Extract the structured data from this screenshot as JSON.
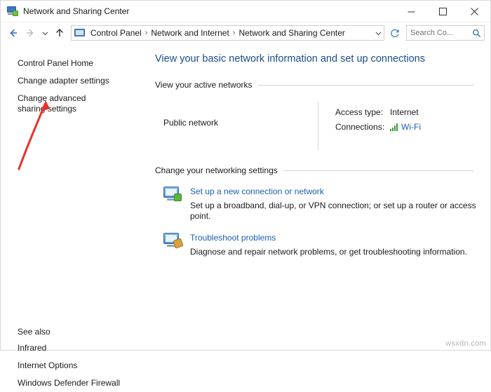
{
  "window": {
    "title": "Network and Sharing Center",
    "app_icon": "network-icon",
    "controls": {
      "minimize": "minimize-icon",
      "maximize": "maximize-icon",
      "close": "close-icon"
    }
  },
  "addressbar": {
    "back": "back-arrow-icon",
    "forward": "forward-arrow-icon",
    "recent": "chevron-down-icon",
    "up": "up-arrow-icon",
    "breadcrumb_icon": "control-panel-icon",
    "breadcrumbs": [
      "Control Panel",
      "Network and Internet",
      "Network and Sharing Center"
    ],
    "separator": "›",
    "dropdown": "chevron-down-icon",
    "refresh": "refresh-icon",
    "search": {
      "placeholder": "Search Co...",
      "icon": "search-icon",
      "value": ""
    }
  },
  "sidebar": {
    "items": [
      {
        "label": "Control Panel Home",
        "name": "sidebar-item-control-panel-home"
      },
      {
        "label": "Change adapter settings",
        "name": "sidebar-item-change-adapter-settings"
      },
      {
        "label": "Change advanced sharing settings",
        "name": "sidebar-item-change-advanced-sharing-settings"
      }
    ],
    "see_also": {
      "heading": "See also",
      "items": [
        {
          "label": "Infrared",
          "name": "sidebar-item-infrared"
        },
        {
          "label": "Internet Options",
          "name": "sidebar-item-internet-options"
        },
        {
          "label": "Windows Defender Firewall",
          "name": "sidebar-item-windows-defender-firewall"
        }
      ]
    }
  },
  "main": {
    "page_title": "View your basic network information and set up connections",
    "active_networks": {
      "heading": "View your active networks",
      "network_name": "Public network",
      "details": [
        {
          "label": "Access type:",
          "value": "Internet"
        },
        {
          "label": "Connections:",
          "value": "Wi-Fi"
        }
      ]
    },
    "settings": {
      "heading": "Change your networking settings",
      "tasks": [
        {
          "icon": "new-connection-icon",
          "link": "Set up a new connection or network",
          "desc": "Set up a broadband, dial-up, or VPN connection; or set up a router or access point."
        },
        {
          "icon": "troubleshoot-icon",
          "link": "Troubleshoot problems",
          "desc": "Diagnose and repair network problems, or get troubleshooting information."
        }
      ]
    }
  },
  "annotation": {
    "arrow_color": "#e8332a",
    "points_to": "Change advanced sharing settings"
  },
  "watermark": "wsxdn.com"
}
